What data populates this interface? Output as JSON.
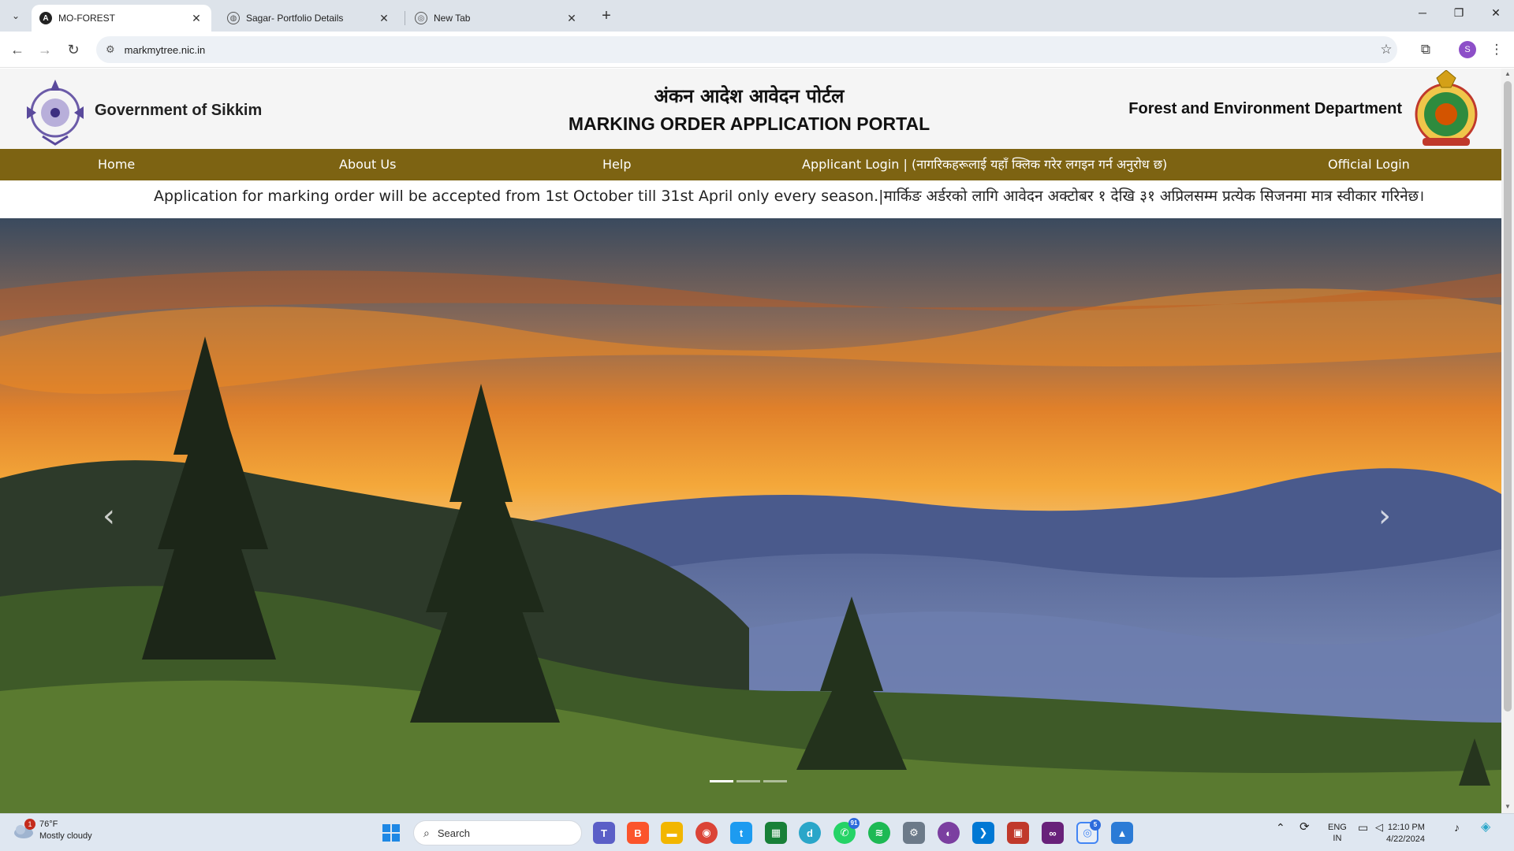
{
  "browser": {
    "tabs": [
      {
        "title": "MO-FOREST",
        "active": true,
        "icon": "angular-icon"
      },
      {
        "title": "Sagar- Portfolio Details",
        "active": false,
        "icon": "globe-icon"
      },
      {
        "title": "New Tab",
        "active": false,
        "icon": "chrome-icon"
      }
    ],
    "url": "markmytree.nic.in",
    "profile_initial": "S"
  },
  "header": {
    "gov_title": "Government of Sikkim",
    "hindi_title": "अंकन आदेश आवेदन पोर्टल",
    "eng_title": "MARKING ORDER APPLICATION PORTAL",
    "dept_title": "Forest and Environment Department"
  },
  "nav": {
    "home": "Home",
    "about": "About Us",
    "help": "Help",
    "applicant_login": "Applicant Login | (नागरिकहरूलाई यहाँ क्लिक गरेर लगइन गर्न अनुरोध छ)",
    "official_login": "Official Login",
    "color": "#7d6312"
  },
  "notice": {
    "text": "Application for marking order will be accepted from 1st October till 31st April only every season.|मार्किङ अर्डरको लागि आवेदन अक्टोबर १ देखि ३१ अप्रिलसम्म प्रत्येक सिजनमा मात्र स्वीकार गरिनेछ।"
  },
  "carousel": {
    "prev_icon": "‹",
    "next_icon": "›",
    "slides": 3,
    "active_slide": 1
  },
  "taskbar": {
    "weather_temp": "76°F",
    "weather_desc": "Mostly cloudy",
    "weather_badge": "1",
    "search_placeholder": "Search",
    "whatsapp_badge": "91",
    "chrome_badge": "5",
    "lang_line1": "ENG",
    "lang_line2": "IN",
    "time": "12:10 PM",
    "date": "4/22/2024"
  }
}
